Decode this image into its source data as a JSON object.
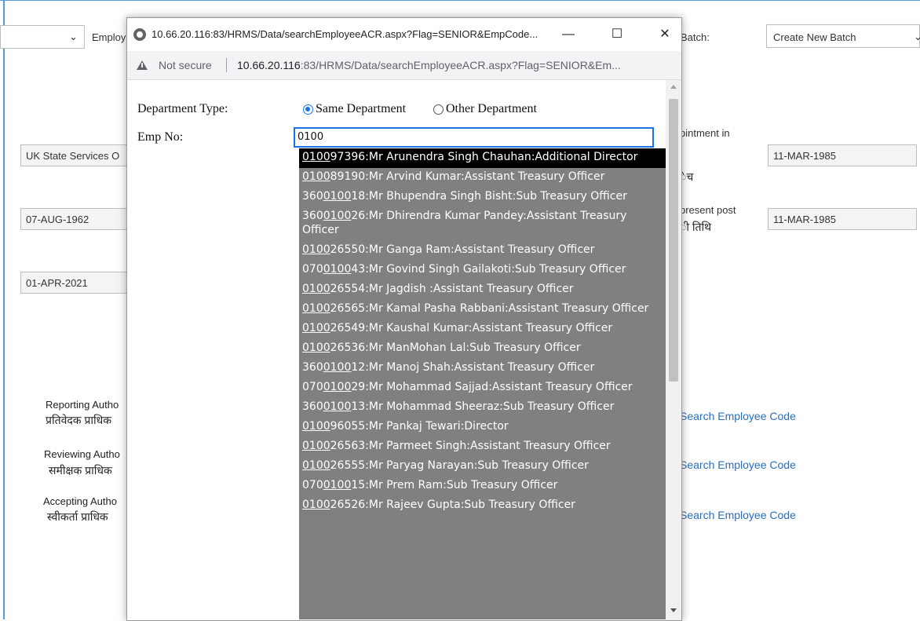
{
  "background_form": {
    "employee_label": "Employ",
    "batch_label": "Batch:",
    "batch_value": "Create New Batch",
    "service_field": "UK State Services  O",
    "dob_field": "07-AUG-1962",
    "from_field": "01-APR-2021",
    "appointment_label": "pintment in",
    "appointment_hindi": "ेच",
    "appointment_date": "11-MAR-1985",
    "present_post_label": "present post",
    "present_post_hindi": "ी तिथि",
    "present_post_date": "11-MAR-1985",
    "reporting_en": "Reporting Autho",
    "reporting_hi": "प्रतिवेदक प्राधिक",
    "reviewing_en": "Reviewing Autho",
    "reviewing_hi": "समीक्षक प्राधिक",
    "accepting_en": "Accepting Autho",
    "accepting_hi": "स्वीकर्ता प्राधिक",
    "search_link": "Search Employee Code"
  },
  "popup": {
    "title": "10.66.20.116:83/HRMS/Data/searchEmployeeACR.aspx?Flag=SENIOR&EmpCode...",
    "not_secure": "Not secure",
    "url_host": "10.66.20.116",
    "url_rest": ":83/HRMS/Data/searchEmployeeACR.aspx?Flag=SENIOR&Em...",
    "department_type_label": "Department Type:",
    "same_department": "Same Department",
    "other_department": "Other Department",
    "emp_no_label": "Emp No:",
    "emp_no_value": "0100",
    "suggestions": [
      {
        "pre": "",
        "match": "0100",
        "post": "97396:Mr Arunendra Singh Chauhan:Additional Director"
      },
      {
        "pre": "",
        "match": "0100",
        "post": "89190:Mr Arvind Kumar:Assistant Treasury Officer"
      },
      {
        "pre": "360",
        "match": "0100",
        "post": "18:Mr Bhupendra Singh Bisht:Sub Treasury Officer"
      },
      {
        "pre": "360",
        "match": "0100",
        "post": "26:Mr Dhirendra Kumar Pandey:Assistant Treasury Officer"
      },
      {
        "pre": "",
        "match": "0100",
        "post": "26550:Mr Ganga Ram:Assistant Treasury Officer"
      },
      {
        "pre": "070",
        "match": "0100",
        "post": "43:Mr Govind Singh Gailakoti:Sub Treasury Officer"
      },
      {
        "pre": "",
        "match": "0100",
        "post": "26554:Mr Jagdish :Assistant Treasury Officer"
      },
      {
        "pre": "",
        "match": "0100",
        "post": "26565:Mr Kamal Pasha Rabbani:Assistant Treasury Officer"
      },
      {
        "pre": "",
        "match": "0100",
        "post": "26549:Mr Kaushal Kumar:Assistant Treasury Officer"
      },
      {
        "pre": "",
        "match": "0100",
        "post": "26536:Mr ManMohan Lal:Sub Treasury Officer"
      },
      {
        "pre": "360",
        "match": "0100",
        "post": "12:Mr Manoj Shah:Assistant Treasury Officer"
      },
      {
        "pre": "070",
        "match": "0100",
        "post": "29:Mr Mohammad Sajjad:Assistant Treasury Officer"
      },
      {
        "pre": "360",
        "match": "0100",
        "post": "13:Mr Mohammad Sheeraz:Sub Treasury Officer"
      },
      {
        "pre": "",
        "match": "0100",
        "post": "96055:Mr Pankaj Tewari:Director"
      },
      {
        "pre": "",
        "match": "0100",
        "post": "26563:Mr Parmeet Singh:Assistant Treasury Officer"
      },
      {
        "pre": "",
        "match": "0100",
        "post": "26555:Mr Paryag Narayan:Sub Treasury Officer"
      },
      {
        "pre": "070",
        "match": "0100",
        "post": "15:Mr Prem Ram:Sub Treasury Officer"
      },
      {
        "pre": "",
        "match": "0100",
        "post": "26526:Mr Rajeev Gupta:Sub Treasury Officer"
      }
    ],
    "selected_index": 0
  }
}
